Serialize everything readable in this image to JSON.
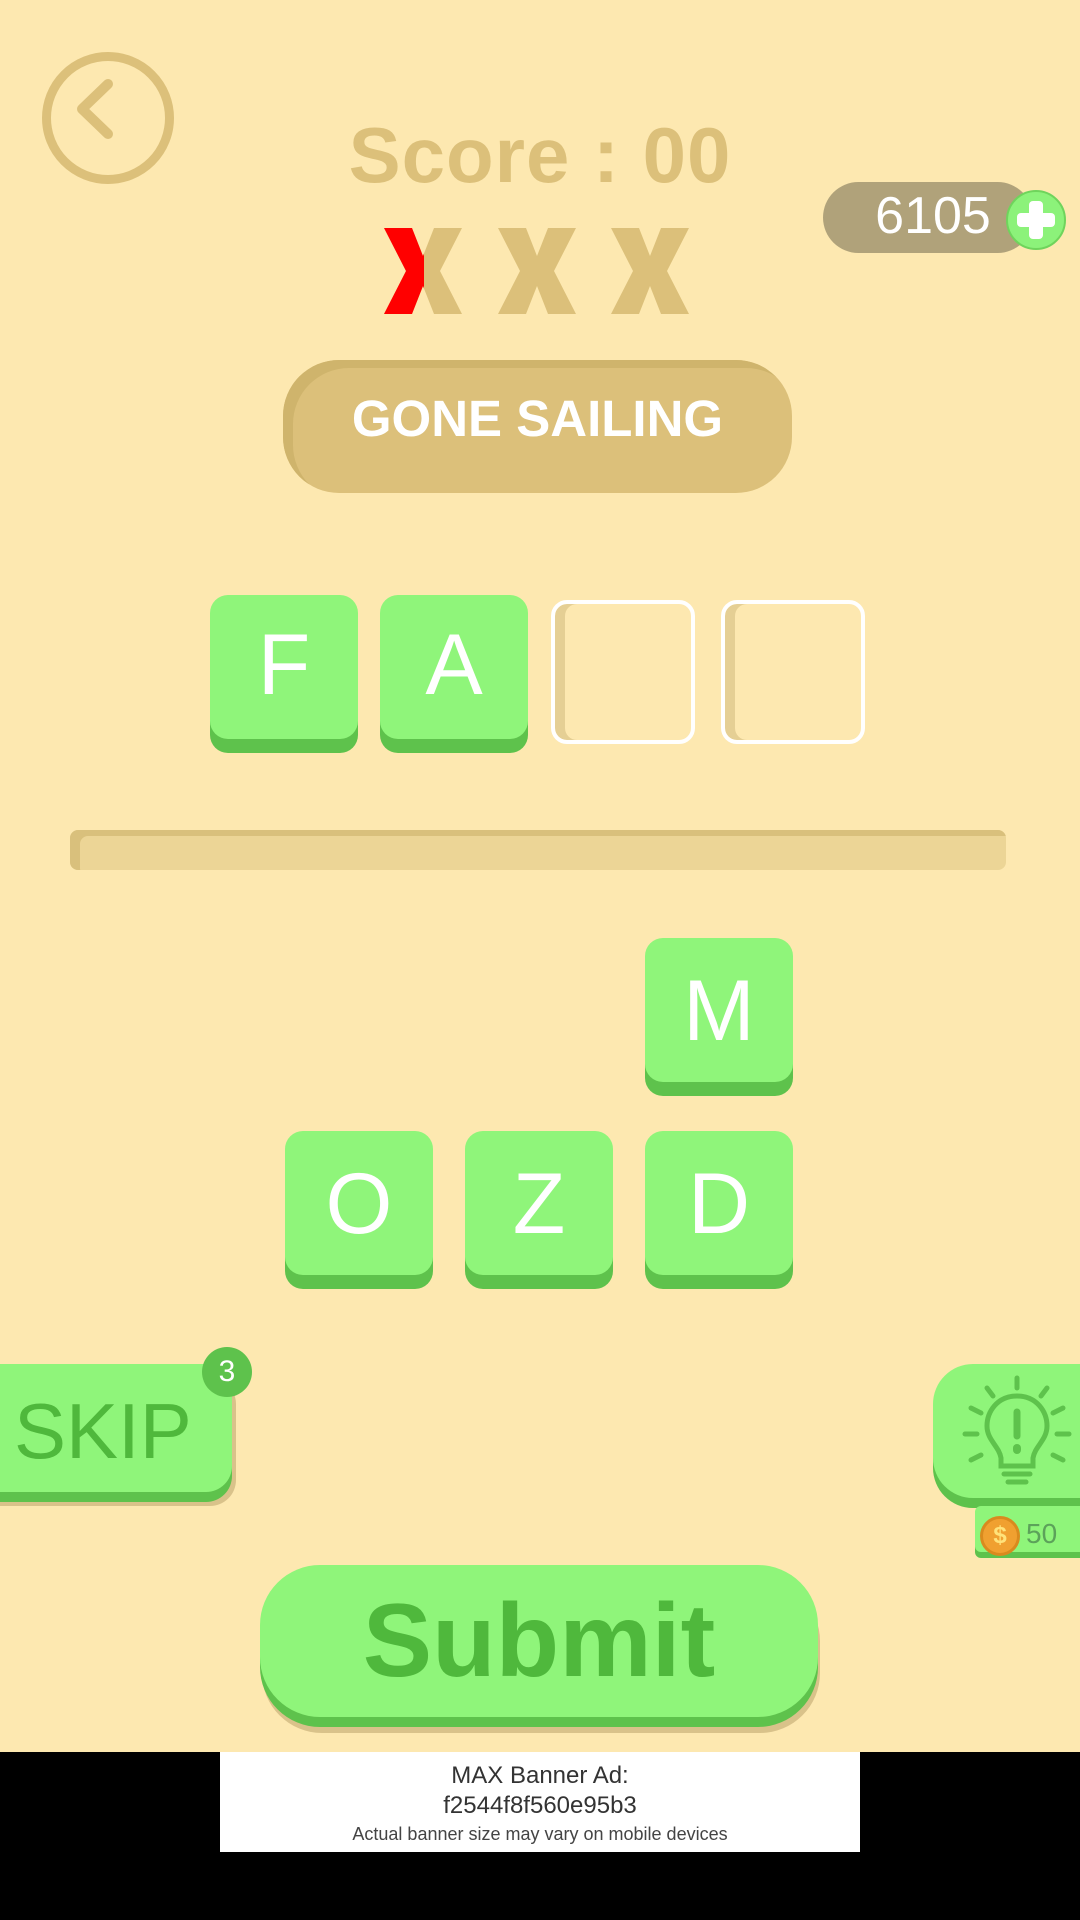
{
  "header": {
    "score_text": "Score : 00",
    "coins": "6105",
    "strikes": {
      "total": 3,
      "used": 0.5,
      "active_color": "#ff0000",
      "inactive_color": "#dcc07a"
    }
  },
  "clue": "GONE SAILING",
  "answer": {
    "tiles": [
      "F",
      "A",
      "",
      ""
    ]
  },
  "bank": {
    "row1": [
      "M"
    ],
    "row2": [
      "O",
      "Z",
      "D"
    ]
  },
  "controls": {
    "skip_label": "SKIP",
    "skip_count": "3",
    "hint_cost": "50",
    "submit_label": "Submit"
  },
  "ad": {
    "title_line1": "MAX Banner Ad:",
    "title_line2": "f2544f8f560e95b3",
    "note": "Actual banner size may vary on mobile devices"
  },
  "colors": {
    "background": "#fde8b0",
    "accent_gold": "#dcc07a",
    "tile_green": "#8ff57a",
    "tile_shadow": "#5ec24c"
  },
  "icons": [
    "back-arrow-icon",
    "plus-icon",
    "lightbulb-icon",
    "coin-icon",
    "x-mark-icon"
  ]
}
